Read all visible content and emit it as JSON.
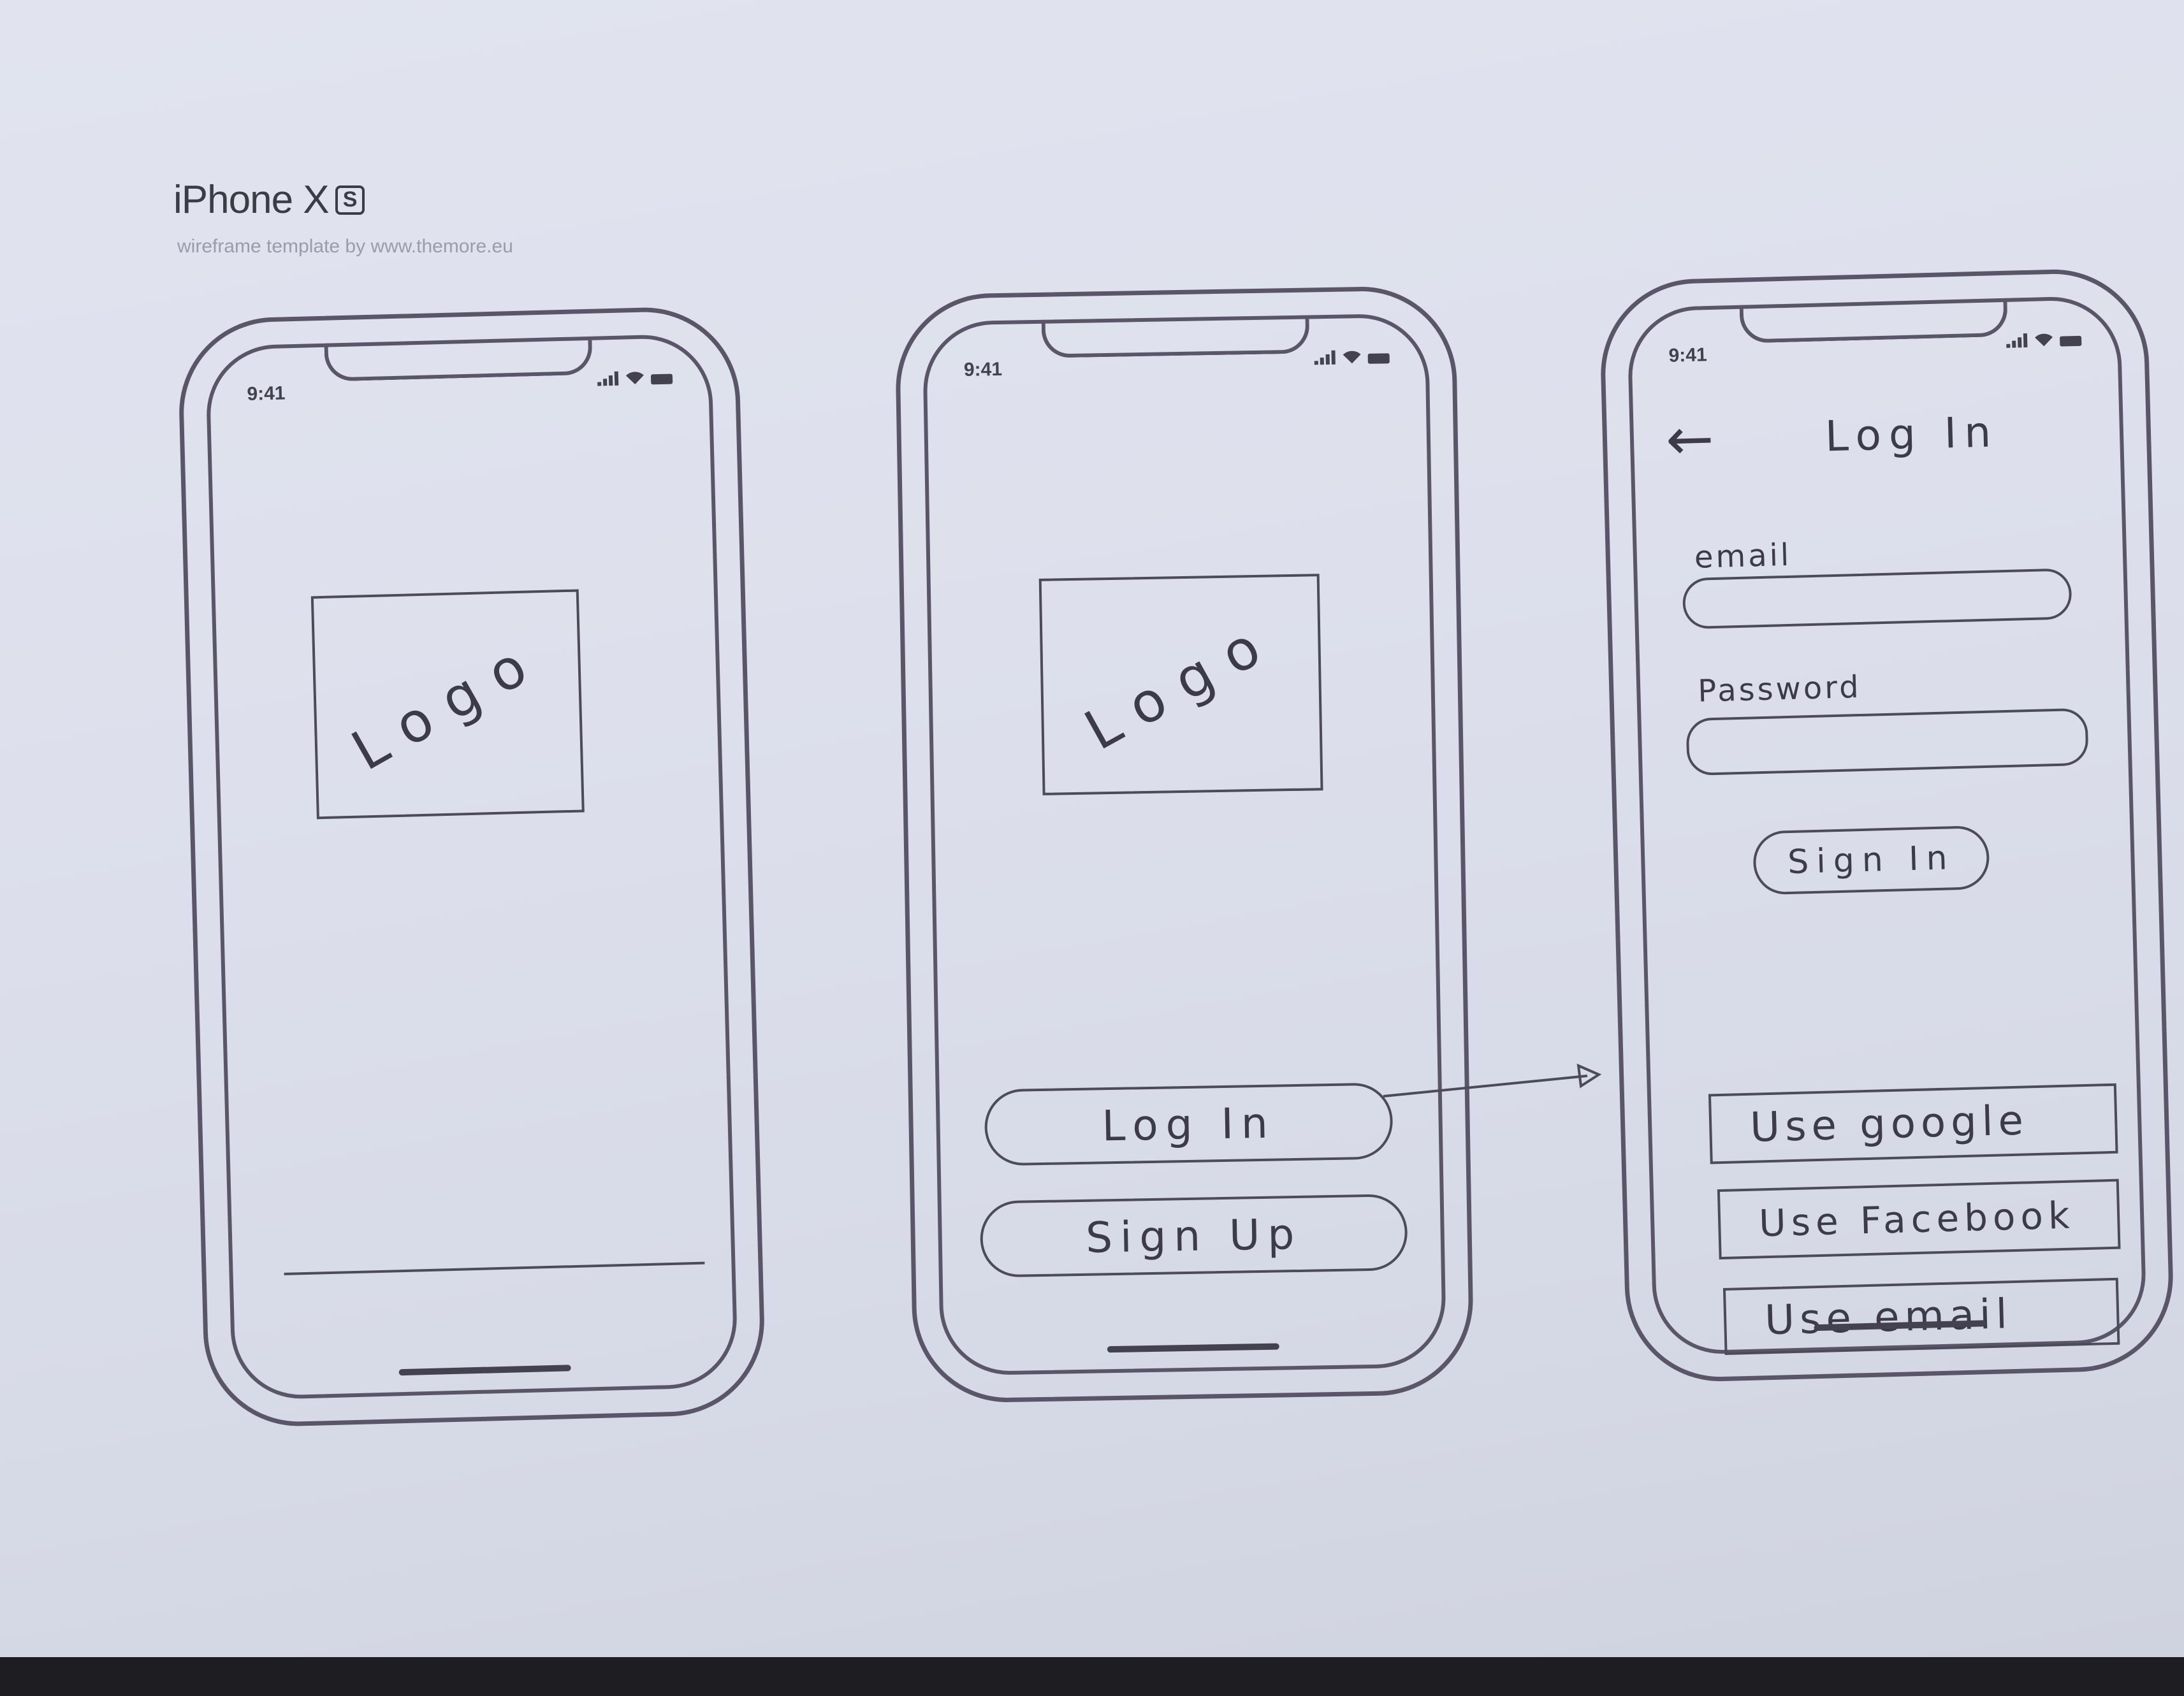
{
  "header": {
    "title": "iPhone X",
    "badge": "S",
    "subtitle": "wireframe template by www.themore.eu"
  },
  "status_bar": {
    "time": "9:41"
  },
  "screen1": {
    "logo": "Logo"
  },
  "screen2": {
    "logo": "Logo",
    "login_label": "Log In",
    "signup_label": "Sign Up"
  },
  "screen3": {
    "title": "Log In",
    "back_glyph": "←",
    "email_label": "email",
    "password_label": "Password",
    "signin_label": "Sign In",
    "google_label": "Use google",
    "facebook_label": "Use Facebook",
    "email_btn_label": "Use email"
  },
  "colors": {
    "ink": "#4d4a5a",
    "paper": "#dde0ec"
  }
}
